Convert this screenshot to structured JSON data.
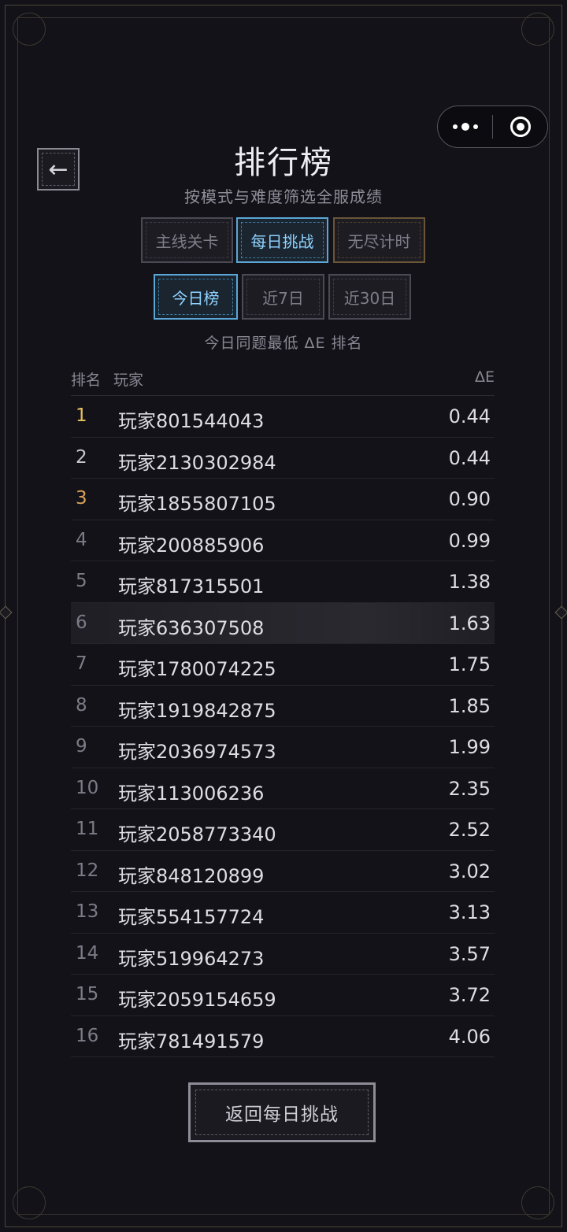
{
  "header": {
    "title": "排行榜",
    "subtitle": "按模式与难度筛选全服成绩",
    "back_glyph": "←"
  },
  "mode_tabs": [
    {
      "label": "主线关卡",
      "active": false
    },
    {
      "label": "每日挑战",
      "active": true
    },
    {
      "label": "无尽计时",
      "active": false
    }
  ],
  "range_tabs": [
    {
      "label": "今日榜",
      "active": true
    },
    {
      "label": "近7日",
      "active": false
    },
    {
      "label": "近30日",
      "active": false
    }
  ],
  "hint": "今日同题最低 ΔE 排名",
  "table": {
    "col_rank": "排名",
    "col_player": "玩家",
    "col_delta": "ΔE",
    "rows": [
      {
        "rank": "1",
        "name": "玩家801544043",
        "delta": "0.44"
      },
      {
        "rank": "2",
        "name": "玩家2130302984",
        "delta": "0.44"
      },
      {
        "rank": "3",
        "name": "玩家1855807105",
        "delta": "0.90"
      },
      {
        "rank": "4",
        "name": "玩家200885906",
        "delta": "0.99"
      },
      {
        "rank": "5",
        "name": "玩家817315501",
        "delta": "1.38"
      },
      {
        "rank": "6",
        "name": "玩家636307508",
        "delta": "1.63"
      },
      {
        "rank": "7",
        "name": "玩家1780074225",
        "delta": "1.75"
      },
      {
        "rank": "8",
        "name": "玩家1919842875",
        "delta": "1.85"
      },
      {
        "rank": "9",
        "name": "玩家2036974573",
        "delta": "1.99"
      },
      {
        "rank": "10",
        "name": "玩家113006236",
        "delta": "2.35"
      },
      {
        "rank": "11",
        "name": "玩家2058773340",
        "delta": "2.52"
      },
      {
        "rank": "12",
        "name": "玩家848120899",
        "delta": "3.02"
      },
      {
        "rank": "13",
        "name": "玩家554157724",
        "delta": "3.13"
      },
      {
        "rank": "14",
        "name": "玩家519964273",
        "delta": "3.57"
      },
      {
        "rank": "15",
        "name": "玩家2059154659",
        "delta": "3.72"
      },
      {
        "rank": "16",
        "name": "玩家781491579",
        "delta": "4.06"
      }
    ]
  },
  "footer": {
    "back_button": "返回每日挑战"
  },
  "capsule": {
    "more_icon": "more-dots-icon",
    "close_icon": "target-icon"
  },
  "colors": {
    "accent_blue": "#5aa6d6",
    "gold_rank": "#e8c05a",
    "bronze_rank": "#d9a25a"
  }
}
